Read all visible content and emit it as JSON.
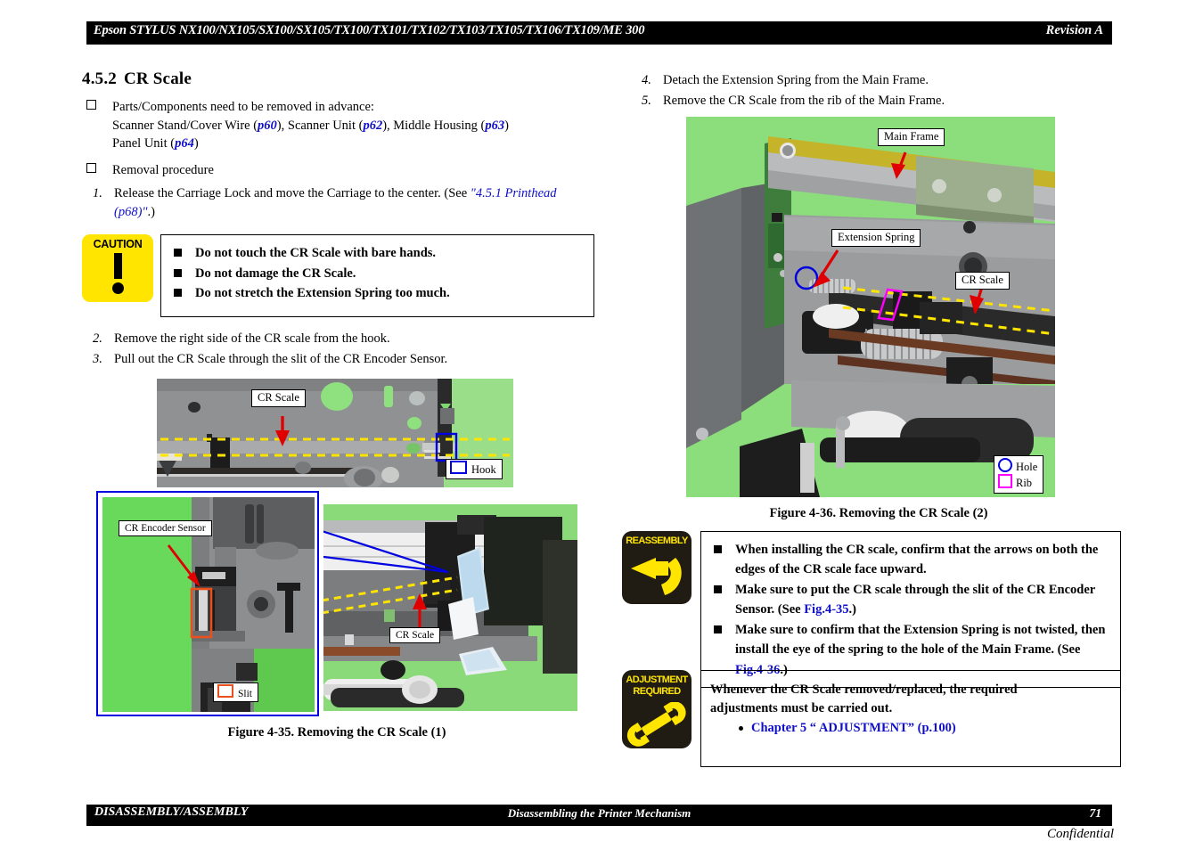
{
  "header": {
    "title": "Epson STYLUS NX100/NX105/SX100/SX105/TX100/TX101/TX102/TX103/TX105/TX106/TX109/ME 300",
    "revision": "Revision A"
  },
  "footer": {
    "left": "DISASSEMBLY/ASSEMBLY",
    "center": "Disassembling the Printer Mechanism",
    "page": "71",
    "confidential": "Confidential"
  },
  "section": {
    "number": "4.5.2",
    "title": "CR Scale"
  },
  "left_column": {
    "prereq_intro": "Parts/Components need to be removed in advance:",
    "prereq_line1_a": "Scanner Stand/Cover Wire (",
    "prereq_ref1": "p60",
    "prereq_line1_b": "), Scanner Unit (",
    "prereq_ref2": "p62",
    "prereq_line1_c": "), Middle Housing (",
    "prereq_ref3": "p63",
    "prereq_line1_d": ")",
    "prereq_line2_a": "Panel Unit (",
    "prereq_ref4": "p64",
    "prereq_line2_b": ")",
    "removal_heading": "Removal procedure",
    "step1_num": "1.",
    "step1_text": "Release the Carriage Lock and move the Carriage to the center. (See ",
    "step1_link": "\"4.5.1 Printhead (p68)\"",
    "step1_tail": ".)",
    "step2_num": "2.",
    "step2_text": "Remove the right side of the CR scale from the hook.",
    "step3_num": "3.",
    "step3_text": "Pull out the CR Scale through the slit of the CR Encoder Sensor."
  },
  "caution": {
    "icon_label": "CAUTION",
    "items": [
      "Do not touch the CR Scale with bare hands.",
      "Do not damage the CR Scale.",
      "Do not stretch the Extension Spring too much."
    ]
  },
  "figure35": {
    "caption": "Figure 4-35.  Removing the CR Scale (1)",
    "top_photo": {
      "label_cr_scale": "CR Scale",
      "legend_hook": "Hook"
    },
    "bottom_left_photo": {
      "label_encoder": "CR Encoder Sensor",
      "legend_slit": "Slit"
    },
    "bottom_right_photo": {
      "label_cr_scale": "CR Scale"
    }
  },
  "right_column": {
    "step4_num": "4.",
    "step4_text": "Detach the Extension Spring from the Main Frame.",
    "step5_num": "5.",
    "step5_text": "Remove the CR Scale from the rib of the Main Frame."
  },
  "figure36": {
    "caption": "Figure 4-36.  Removing the CR Scale (2)",
    "label_main_frame": "Main Frame",
    "label_extension_spring": "Extension Spring",
    "label_cr_scale": "CR Scale",
    "legend_hole": "Hole",
    "legend_rib": "Rib"
  },
  "reassembly": {
    "icon_label": "REASSEMBLY",
    "item1": "When installing the CR scale, confirm that the arrows on both the edges of the CR scale face upward.",
    "item2_a": "Make sure to put the CR scale through the slit of the CR Encoder Sensor. (See ",
    "item2_link": "Fig.4-35",
    "item2_b": ".)",
    "item3_a": "Make sure to confirm that the Extension Spring is not twisted, then install the eye of the spring to the hole of the Main Frame. (See ",
    "item3_link": "Fig.4-36",
    "item3_b": ".)"
  },
  "adjustment": {
    "icon_label_1": "ADJUSTMENT",
    "icon_label_2": "REQUIRED",
    "body_line1": "Whenever the CR Scale removed/replaced, the required",
    "body_line2": "adjustments must be carried out.",
    "link": "Chapter 5 “ ADJUSTMENT” (p.100)"
  },
  "colors": {
    "link_blue": "#1010c8",
    "caution_yellow": "#FFE500",
    "icon_dark": "#201c14",
    "callout_red": "#e00000",
    "dash_yellow": "#ffe400",
    "hook_blue": "#0000e0",
    "slit_orange": "#e8501e",
    "rib_magenta": "#ff00ff",
    "photo_green": "#9ade8a"
  }
}
